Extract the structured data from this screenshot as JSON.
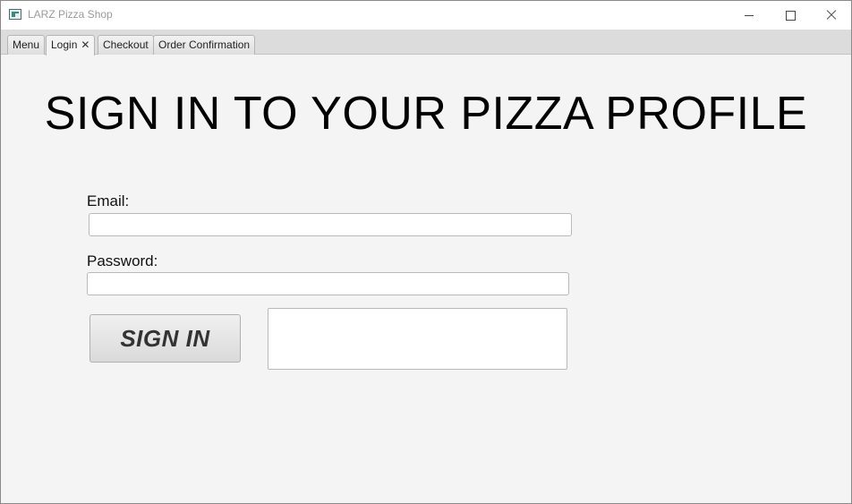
{
  "window": {
    "title": "LARZ Pizza Shop"
  },
  "tabs": [
    {
      "label": "Menu"
    },
    {
      "label": "Login",
      "close": "✕",
      "active": true
    },
    {
      "label": "Checkout"
    },
    {
      "label": "Order Confirmation"
    }
  ],
  "login": {
    "heading": "SIGN IN TO YOUR PIZZA PROFILE",
    "email_label": "Email:",
    "email_value": "",
    "password_label": "Password:",
    "password_value": "",
    "signin_label": "SIGN IN",
    "message": ""
  },
  "colors": {
    "background": "#f4f4f4",
    "tabbar": "#dcdcdc",
    "text": "#000000"
  }
}
